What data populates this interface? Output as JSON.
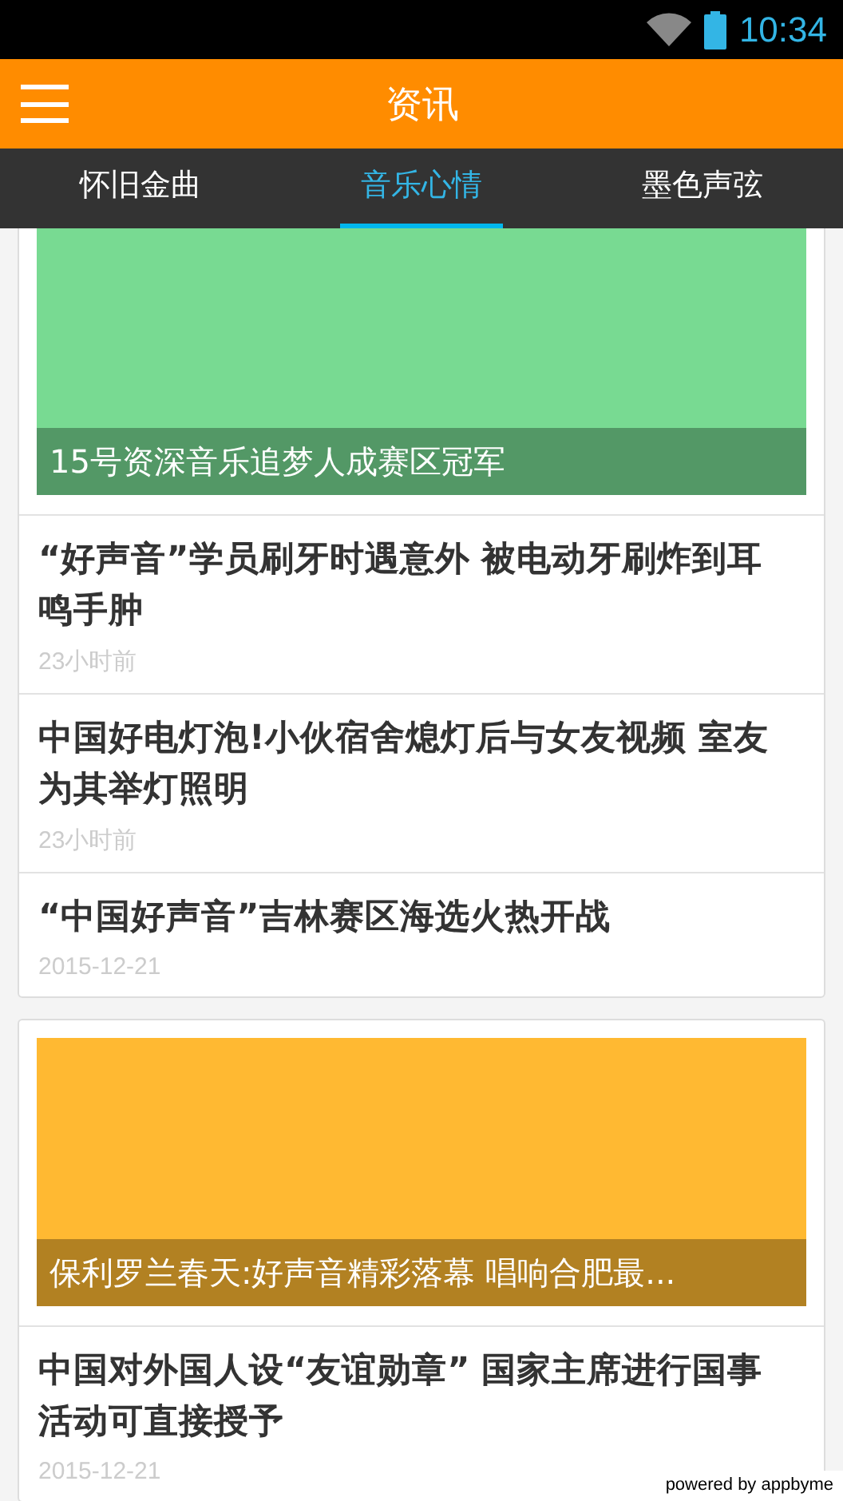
{
  "status_bar": {
    "time": "10:34"
  },
  "header": {
    "title": "资讯"
  },
  "tabs": [
    {
      "label": "怀旧金曲",
      "selected": false
    },
    {
      "label": "音乐心情",
      "selected": true
    },
    {
      "label": "墨色声弦",
      "selected": false
    }
  ],
  "cards": [
    {
      "featured": {
        "caption": "15号资深音乐追梦人成赛区冠军",
        "color": "#78da92"
      },
      "items": [
        {
          "title": "“好声音”学员刷牙时遇意外 被电动牙刷炸到耳鸣手肿",
          "time": "23小时前"
        },
        {
          "title": "中国好电灯泡!小伙宿舍熄灯后与女友视频 室友为其举灯照明",
          "time": "23小时前"
        },
        {
          "title": "“中国好声音”吉林赛区海选火热开战",
          "time": "2015-12-21"
        }
      ]
    },
    {
      "featured": {
        "caption": "保利罗兰春天:好声音精彩落幕 唱响合肥最...",
        "color": "#ffb932"
      },
      "items": [
        {
          "title": "中国对外国人设“友谊勋章” 国家主席进行国事活动可直接授予",
          "time": "2015-12-21"
        }
      ]
    }
  ],
  "footer_badge": "powered by appbyme"
}
